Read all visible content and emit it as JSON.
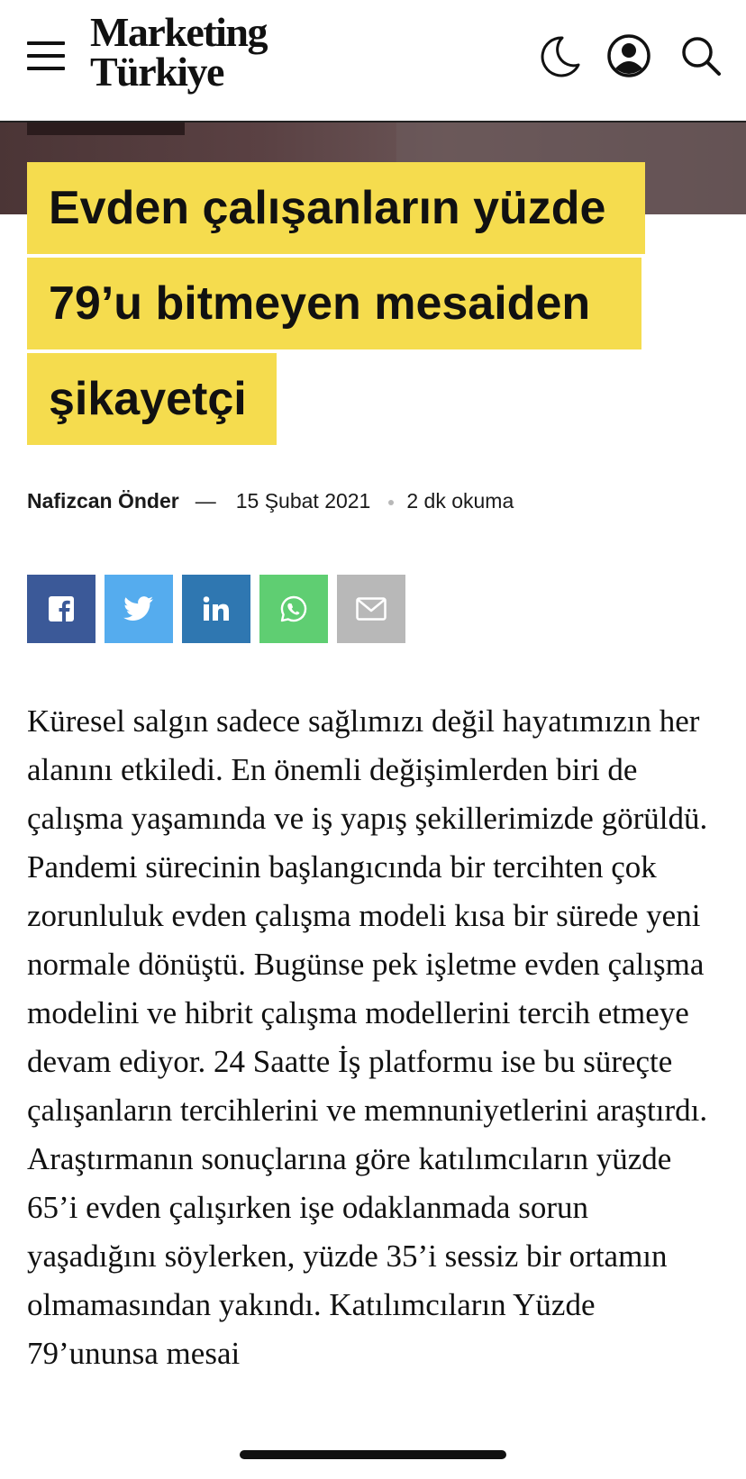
{
  "header": {
    "logo_line1": "Marketing",
    "logo_line2": "Türkiye",
    "icons": [
      "menu-icon",
      "moon-icon",
      "user-icon",
      "search-icon"
    ]
  },
  "article": {
    "title_lines": [
      "Evden çalışanların yüzde",
      "79’u bitmeyen mesaiden",
      "şikayetçi"
    ],
    "author": "Nafizcan Önder",
    "separator": "—",
    "date": "15 Şubat 2021",
    "read_time": "2 dk okuma",
    "body": "Küresel salgın sadece sağlımızı değil hayatımızın her alanını etkiledi. En önemli değişimlerden biri de çalışma yaşamında ve iş yapış şekillerimizde görüldü. Pandemi sürecinin başlangıcında bir tercihten çok zorunluluk evden çalışma modeli kısa bir sürede yeni normale dönüştü. Bugünse pek işletme evden çalışma modelini ve hibrit çalışma modellerini tercih etmeye devam ediyor. 24 Saatte İş platformu ise bu süreçte çalışanların tercihlerini ve memnuniyetlerini araştırdı. Araştırmanın sonuçlarına göre katılımcıların yüzde 65’i evden çalışırken işe odaklanmada sorun yaşadığını söylerken, yüzde 35’i sessiz bir ortamın olmamasından yakındı. Katılımcıların Yüzde 79’ununsa mesai"
  },
  "share": [
    {
      "name": "facebook",
      "icon": "facebook-icon",
      "color": "#3b5998"
    },
    {
      "name": "twitter",
      "icon": "twitter-icon",
      "color": "#55acee"
    },
    {
      "name": "linkedin",
      "icon": "linkedin-icon",
      "color": "#2f77b1"
    },
    {
      "name": "whatsapp",
      "icon": "whatsapp-icon",
      "color": "#5fce72"
    },
    {
      "name": "email",
      "icon": "email-icon",
      "color": "#b8b8b8"
    }
  ],
  "colors": {
    "title_highlight": "#f5dc4e",
    "text": "#111111"
  }
}
